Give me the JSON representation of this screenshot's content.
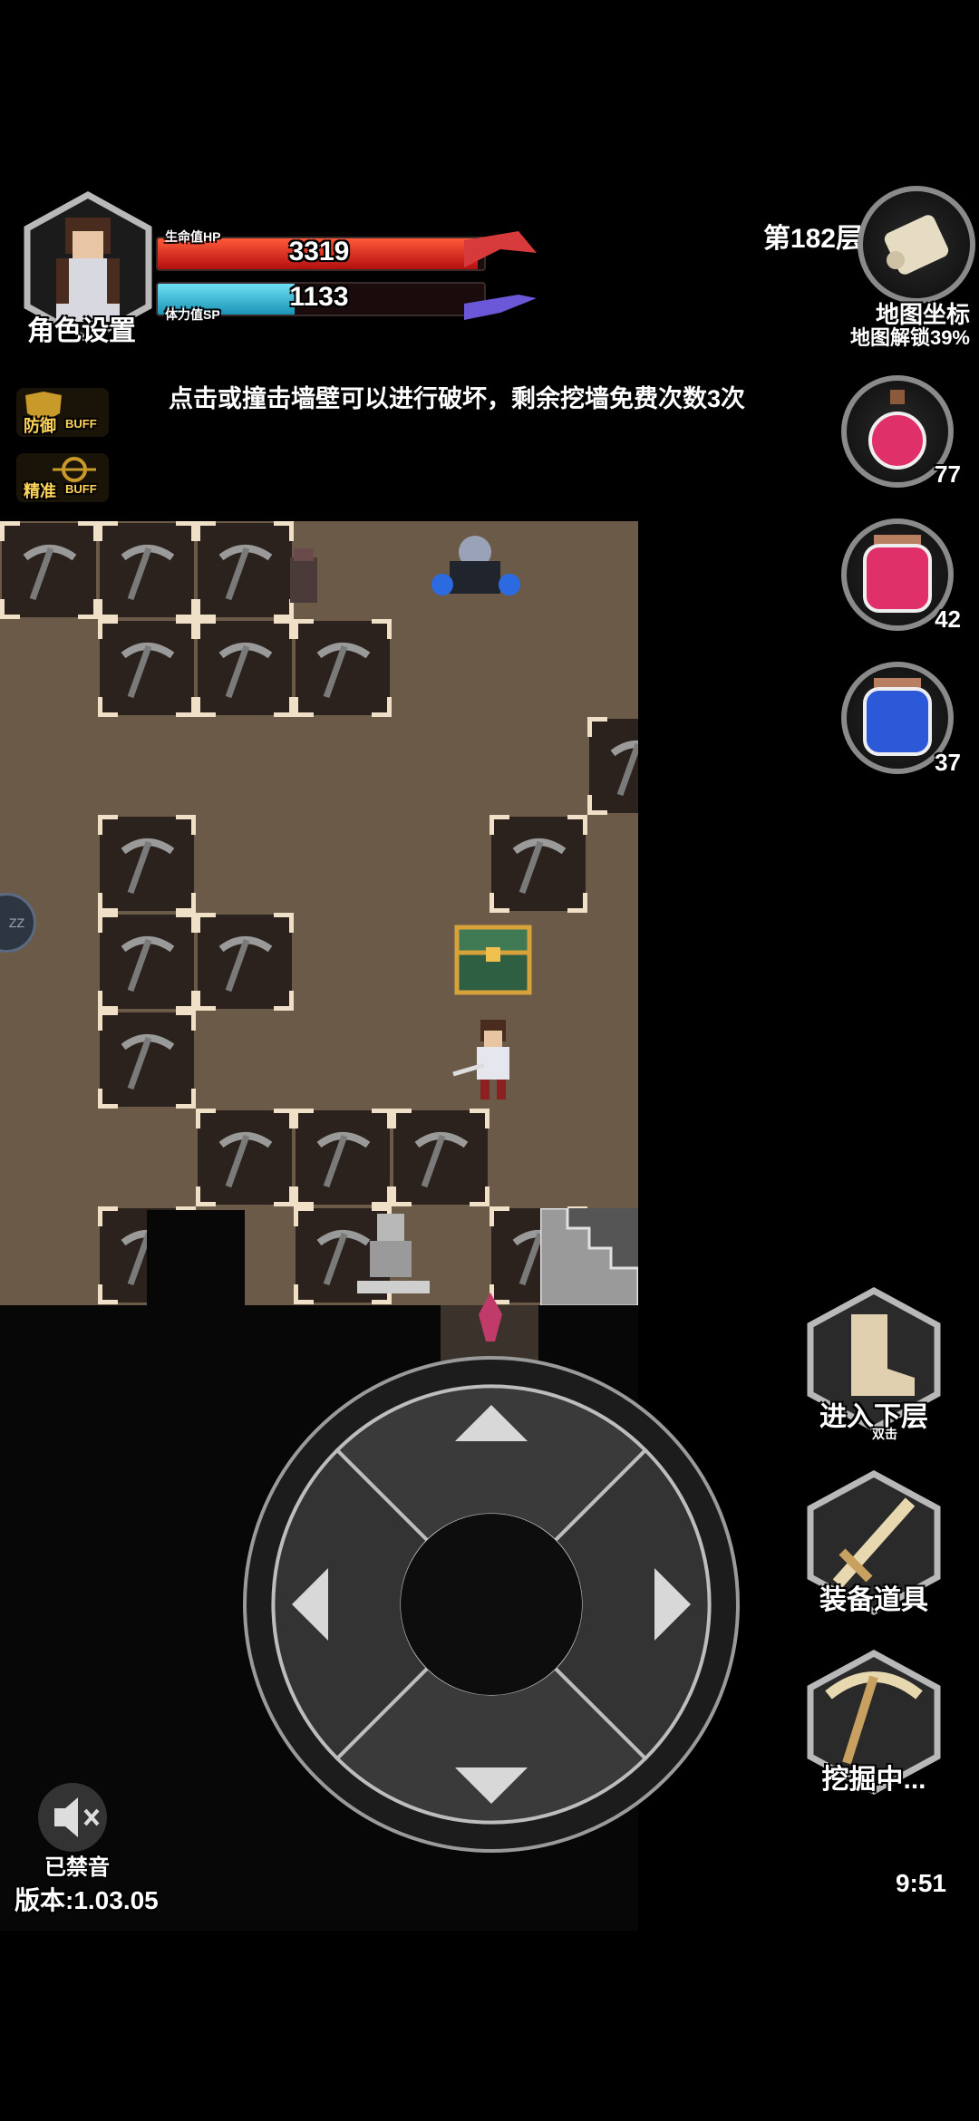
{
  "character": {
    "label": "角色设置",
    "hp_label": "生命值HP",
    "hp_value": "3319",
    "hp_fraction": 0.98,
    "sp_label": "体力值SP",
    "sp_value": "1133",
    "sp_fraction": 0.42
  },
  "floor": "第182层",
  "map_button": {
    "label": "地图坐标",
    "progress": "地图解锁39%"
  },
  "hint": "点击或撞击墙壁可以进行破坏，剩余挖墙免费次数3次",
  "buffs": [
    {
      "label": "防御",
      "tag": "BUFF"
    },
    {
      "label": "精准",
      "tag": "BUFF"
    }
  ],
  "potions": [
    {
      "name": "red-potion-small",
      "count": "77",
      "color": "#e0306a"
    },
    {
      "name": "red-potion-jar",
      "count": "42",
      "color": "#e0306a"
    },
    {
      "name": "blue-potion-jar",
      "count": "37",
      "color": "#2b59d8"
    }
  ],
  "actions": [
    {
      "name": "next-floor",
      "label": "进入下层",
      "sub": "双击"
    },
    {
      "name": "equipment",
      "label": "装备道具",
      "sub": ""
    },
    {
      "name": "digging",
      "label": "挖掘中...",
      "sub": ""
    }
  ],
  "edge_badge": "ZZ",
  "mute_label": "已禁音",
  "version": "版本:1.03.05",
  "clock": "9:51",
  "colors": {
    "hp": "#e0281e",
    "sp": "#27b8d8",
    "ground": "#6b5a47",
    "wall": "#2b221d"
  }
}
